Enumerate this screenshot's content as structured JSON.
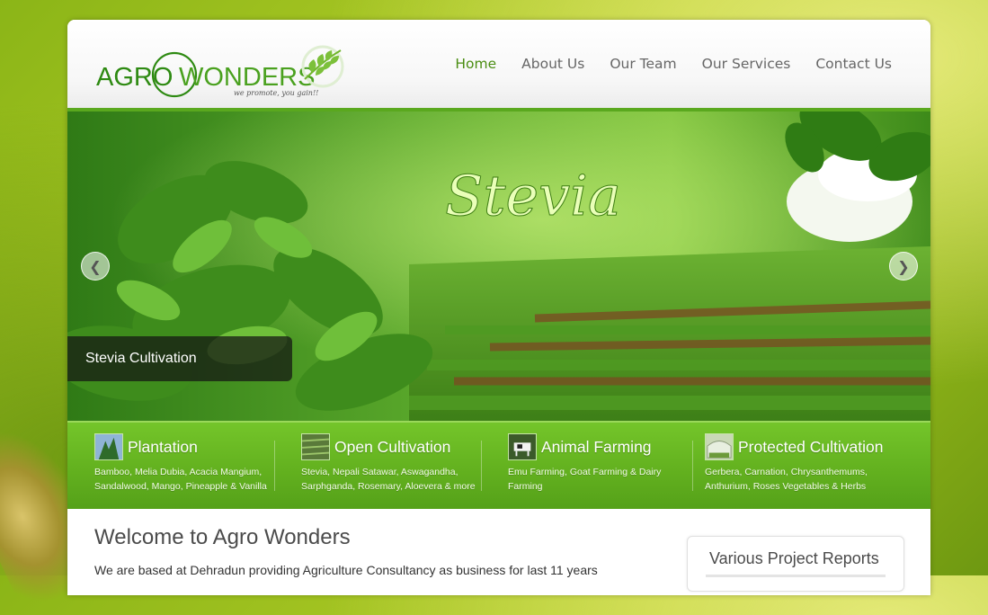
{
  "brand": {
    "logo_left": "AGRO",
    "logo_right": "WONDERS",
    "tagline": "we promote, you gain!!",
    "colors": {
      "green": "#4a9a1a",
      "dark_green": "#2e7a0f"
    }
  },
  "nav": {
    "items": [
      {
        "label": "Home",
        "active": true
      },
      {
        "label": "About Us",
        "active": false
      },
      {
        "label": "Our Team",
        "active": false
      },
      {
        "label": "Our Services",
        "active": false
      },
      {
        "label": "Contact Us",
        "active": false
      }
    ]
  },
  "slider": {
    "banner_text": "Stevia",
    "caption": "Stevia Cultivation",
    "prev_icon": "arrow-left-icon",
    "next_icon": "arrow-right-icon"
  },
  "services": [
    {
      "title": "Plantation",
      "desc_line1": "Bamboo, Melia Dubia, Acacia Mangium,",
      "desc_line2": "Sandalwood, Mango, Pineapple & Vanilla"
    },
    {
      "title": "Open Cultivation",
      "desc_line1": "Stevia, Nepali Satawar, Aswagandha,",
      "desc_line2": "Sarphganda, Rosemary, Aloevera & more"
    },
    {
      "title": "Animal Farming",
      "desc_line1": "Emu Farming, Goat Farming & Dairy",
      "desc_line2": "Farming"
    },
    {
      "title": "Protected Cultivation",
      "desc_line1": "Gerbera, Carnation, Chrysanthemums,",
      "desc_line2": "Anthurium, Roses Vegetables & Herbs"
    }
  ],
  "content": {
    "welcome_title": "Welcome to Agro Wonders",
    "intro": "We are based at Dehradun providing Agriculture Consultancy as business for last 11 years",
    "reports_title": "Various Project Reports"
  }
}
